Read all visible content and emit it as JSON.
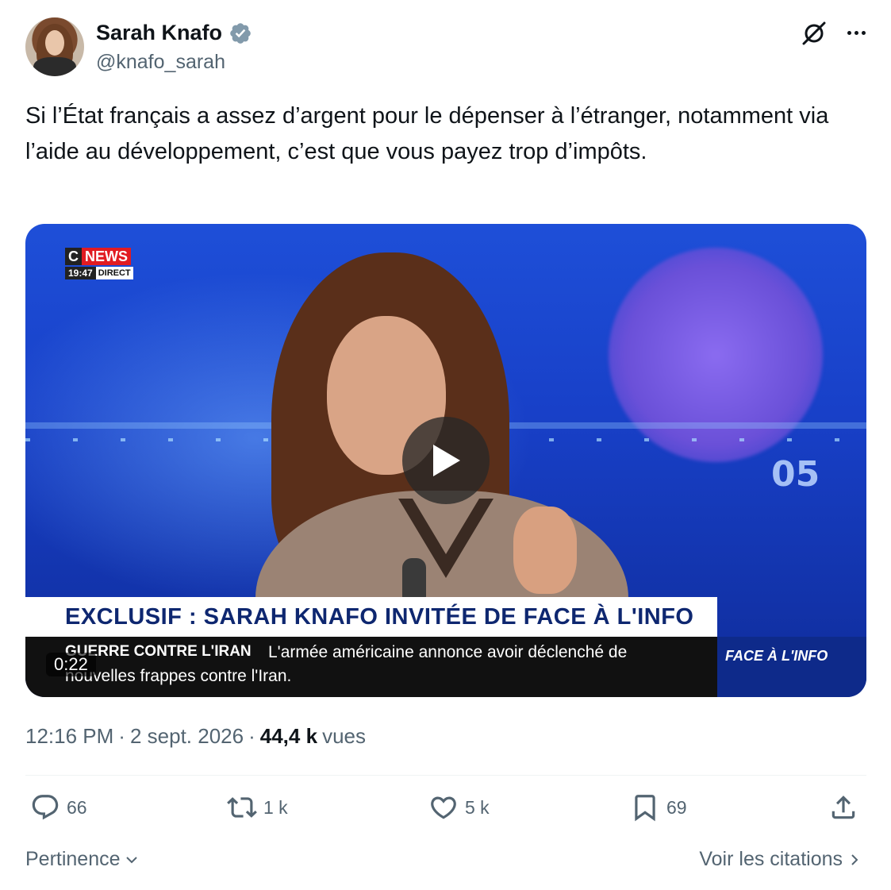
{
  "author": {
    "display_name": "Sarah Knafo",
    "handle": "@knafo_sarah",
    "verified": true
  },
  "tweet": {
    "text": "Si l’État français a assez d’argent pour le dépenser à l’étranger, notamment via l’aide au développement, c’est que vous payez trop d’impôts."
  },
  "media": {
    "channel_logo_c": "C",
    "channel_logo_news": "NEWS",
    "clock": "19:47",
    "live_label": "DIRECT",
    "banner": "EXCLUSIF : SARAH KNAFO INVITÉE DE FACE À L'INFO",
    "ticker_label": "GUERRE CONTRE L'IRAN",
    "ticker_line1": "L'armée américaine annonce avoir déclenché de",
    "ticker_line2": "nouvelles frappes contre l'Iran.",
    "side_tag": "FACE À L'INFO",
    "background_number": "05",
    "duration": "0:22"
  },
  "meta": {
    "time": "12:16 PM",
    "sep1": "·",
    "date": "2 sept. 2026",
    "sep2": "·",
    "views_count": "44,4 k",
    "views_label": "vues"
  },
  "actions": {
    "replies": "66",
    "reposts": "1 k",
    "likes": "5 k",
    "bookmarks": "69"
  },
  "footer": {
    "sort_label": "Pertinence",
    "quotes_label": "Voir les citations"
  },
  "colors": {
    "text_primary": "#0f1419",
    "text_secondary": "#536471",
    "verified_blue": "#1d9bf0",
    "divider": "#eff3f4"
  },
  "icons": [
    "verified-badge-icon",
    "grok-icon",
    "more-icon",
    "play-icon",
    "reply-icon",
    "repost-icon",
    "like-icon",
    "bookmark-icon",
    "share-icon",
    "chevron-down-icon",
    "chevron-right-icon"
  ]
}
